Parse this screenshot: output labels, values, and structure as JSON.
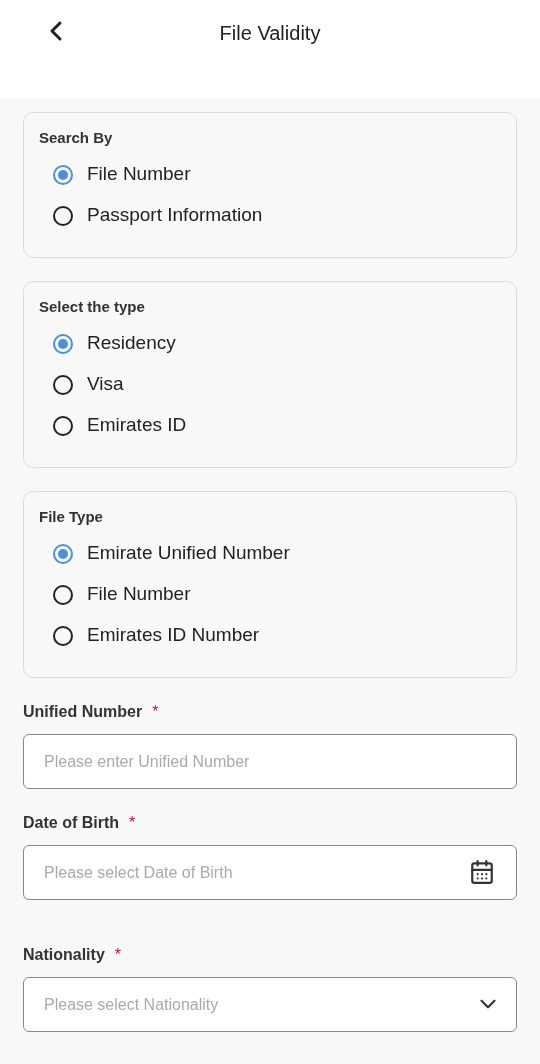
{
  "header": {
    "title": "File Validity"
  },
  "radio_groups": [
    {
      "label": "Search By",
      "options": [
        {
          "label": "File Number",
          "selected": true
        },
        {
          "label": "Passport Information",
          "selected": false
        }
      ]
    },
    {
      "label": "Select the type",
      "options": [
        {
          "label": "Residency",
          "selected": true
        },
        {
          "label": "Visa",
          "selected": false
        },
        {
          "label": "Emirates ID",
          "selected": false
        }
      ]
    },
    {
      "label": "File Type",
      "options": [
        {
          "label": "Emirate Unified Number",
          "selected": true
        },
        {
          "label": "File Number",
          "selected": false
        },
        {
          "label": "Emirates ID Number",
          "selected": false
        }
      ]
    }
  ],
  "fields": [
    {
      "kind": "text",
      "label": "Unified Number",
      "required_mark": "*",
      "placeholder": "Please enter Unified Number"
    },
    {
      "kind": "date",
      "label": "Date of Birth",
      "required_mark": "*",
      "placeholder": "Please select Date of Birth"
    },
    {
      "kind": "select",
      "label": "Nationality",
      "required_mark": "*",
      "placeholder": "Please select Nationality"
    }
  ]
}
